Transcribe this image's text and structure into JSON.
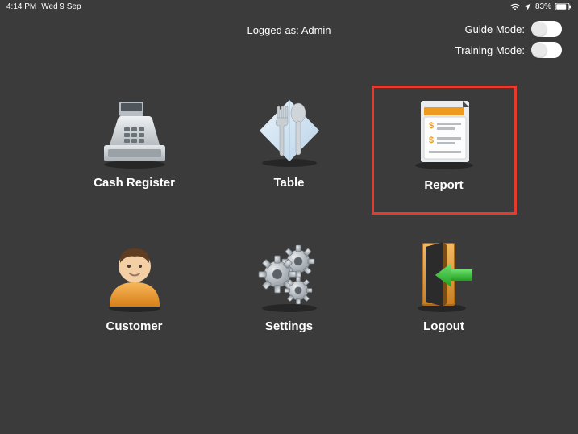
{
  "status_bar": {
    "time": "4:14 PM",
    "date": "Wed 9 Sep",
    "battery_pct": "83%"
  },
  "header": {
    "logged_as": "Logged as: Admin",
    "toggles": {
      "guide_mode_label": "Guide Mode:",
      "training_mode_label": "Training Mode:",
      "guide_mode_on": false,
      "training_mode_on": false
    }
  },
  "menu": {
    "items": [
      {
        "id": "cash-register",
        "label": "Cash Register",
        "highlighted": false
      },
      {
        "id": "table",
        "label": "Table",
        "highlighted": false
      },
      {
        "id": "report",
        "label": "Report",
        "highlighted": true
      },
      {
        "id": "customer",
        "label": "Customer",
        "highlighted": false
      },
      {
        "id": "settings",
        "label": "Settings",
        "highlighted": false
      },
      {
        "id": "logout",
        "label": "Logout",
        "highlighted": false
      }
    ]
  },
  "colors": {
    "highlight_border": "#e53a2e",
    "accent_orange": "#ee9a1f"
  }
}
